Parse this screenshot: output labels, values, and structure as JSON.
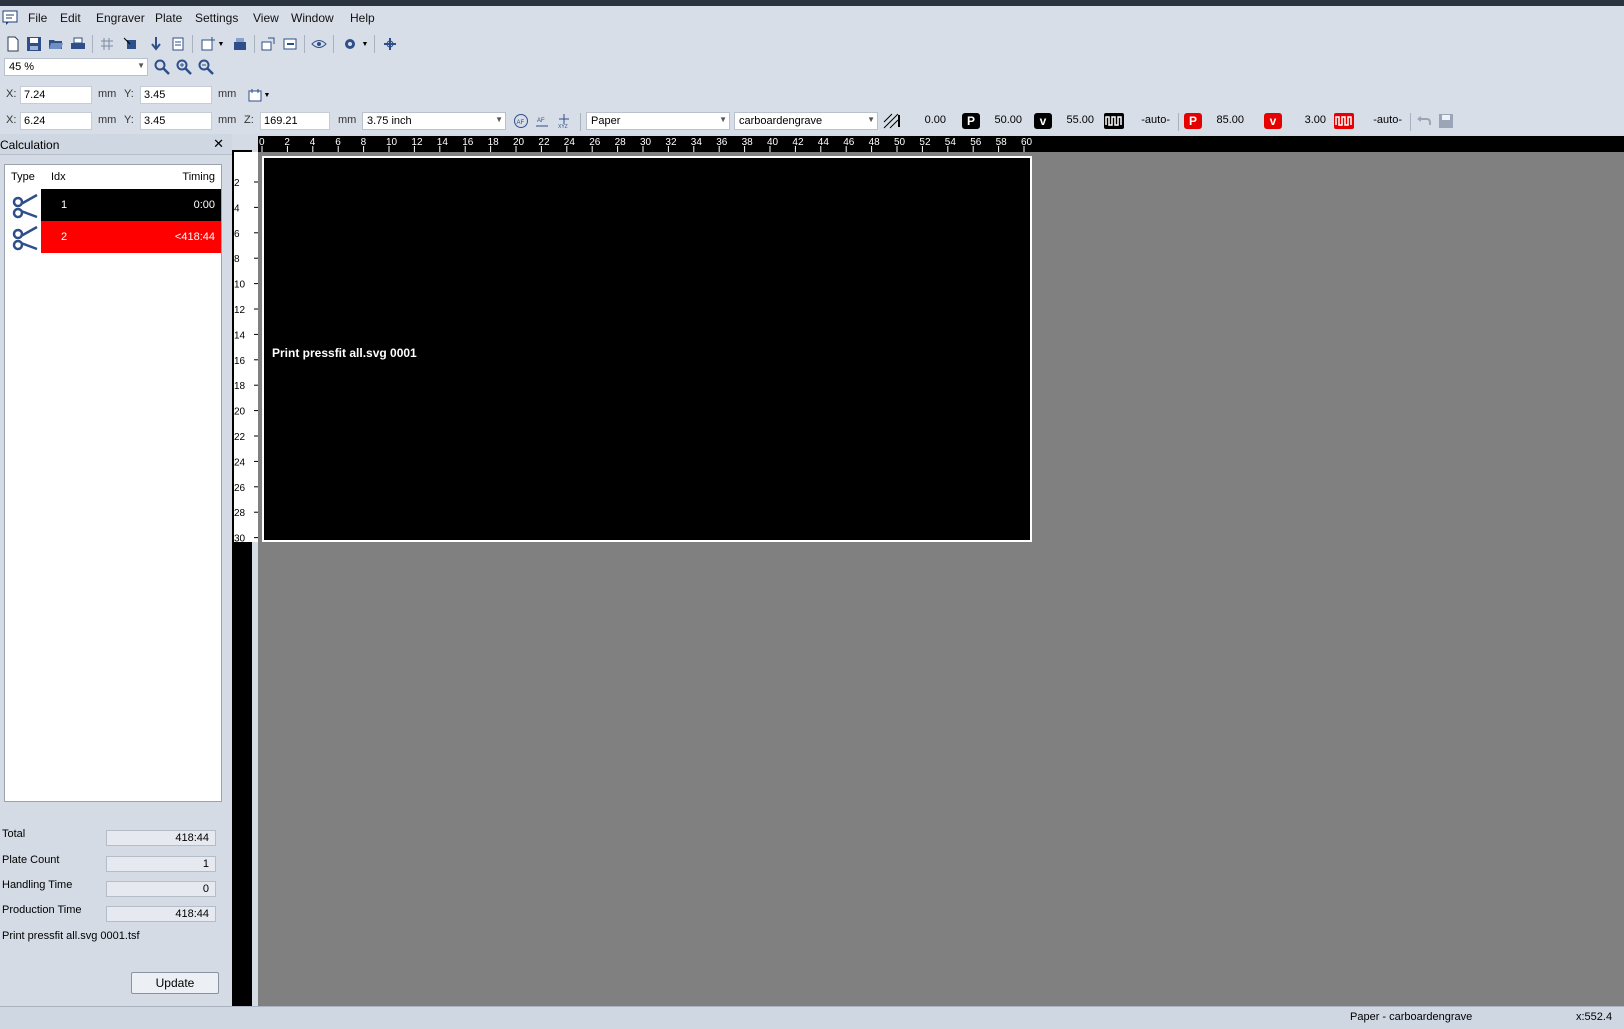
{
  "menu": [
    "File",
    "Edit",
    "Engraver",
    "Plate",
    "Settings",
    "View",
    "Window",
    "Help"
  ],
  "zoom": {
    "value": "45 %"
  },
  "coords1": {
    "x_label": "X:",
    "x": "7.24",
    "x_unit": "mm",
    "y_label": "Y:",
    "y": "3.45",
    "y_unit": "mm"
  },
  "coords2": {
    "x_label": "X:",
    "x": "6.24",
    "x_unit": "mm",
    "y_label": "Y:",
    "y": "3.45",
    "y_unit": "mm",
    "z_label": "Z:",
    "z": "169.21",
    "z_unit": "mm",
    "thickness": "3.75 inch"
  },
  "material": {
    "name": "Paper",
    "process": "carboardengrave",
    "offset": "0.00",
    "engrave": {
      "p_badge": "P",
      "power": "50.00",
      "v_badge": "v",
      "velocity": "55.00",
      "freq": "-auto-"
    },
    "cut": {
      "p_badge": "P",
      "power": "85.00",
      "v_badge": "v",
      "velocity": "3.00",
      "freq": "-auto-"
    },
    "colors": {
      "engrave": "#000000",
      "cut": "#e60000"
    }
  },
  "ruler": {
    "top_ticks": [
      "0",
      "2",
      "4",
      "6",
      "8",
      "10",
      "12",
      "14",
      "16",
      "18",
      "20",
      "22",
      "24",
      "26",
      "28",
      "30",
      "32",
      "34",
      "36",
      "38",
      "40",
      "42",
      "44",
      "46",
      "48",
      "50",
      "52",
      "54",
      "56",
      "58",
      "60"
    ],
    "left_ticks": [
      "2",
      "4",
      "6",
      "8",
      "10",
      "12",
      "14",
      "16",
      "18",
      "20",
      "22",
      "24",
      "26",
      "28",
      "30"
    ]
  },
  "panel": {
    "title": "Calculation",
    "columns": {
      "type": "Type",
      "idx": "Idx",
      "timing": "Timing"
    },
    "rows": [
      {
        "idx": "1",
        "timing": "0:00",
        "color": "#000000"
      },
      {
        "idx": "2",
        "timing": "<418:44",
        "color": "#ff0000"
      }
    ],
    "summary": {
      "total_label": "Total",
      "total": "418:44",
      "plate_count_label": "Plate Count",
      "plate_count": "1",
      "handling_label": "Handling Time",
      "handling": "0",
      "production_label": "Production Time",
      "production": "418:44"
    },
    "file": "Print pressfit all.svg 0001.tsf",
    "update_label": "Update"
  },
  "plate": {
    "label": "Print pressfit all.svg 0001"
  },
  "status": {
    "text": "Paper - carboardengrave",
    "x": "x:552.4"
  }
}
